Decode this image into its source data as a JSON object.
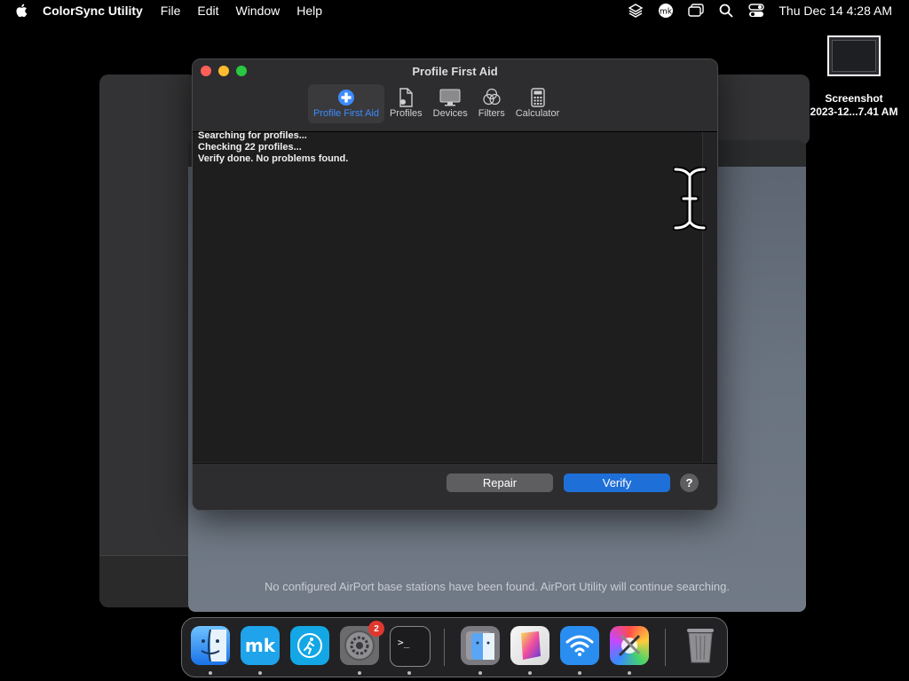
{
  "menubar": {
    "app_name": "ColorSync Utility",
    "menus": [
      "File",
      "Edit",
      "Window",
      "Help"
    ],
    "right_icons": [
      "layers-icon",
      "mk-icon",
      "window-switch-icon",
      "search-icon",
      "control-center-icon"
    ],
    "clock": "Thu Dec 14  4:28 AM"
  },
  "desktop_icon": {
    "name_line1": "Screenshot",
    "name_line2": "2023-12...7.41 AM"
  },
  "airport_window": {
    "message": "No configured AirPort base stations have been found. AirPort Utility will continue searching."
  },
  "window": {
    "title": "Profile First Aid",
    "toolbar": [
      {
        "label": "Profile First Aid",
        "icon": "first-aid-icon",
        "active": true
      },
      {
        "label": "Profiles",
        "icon": "profiles-icon",
        "active": false
      },
      {
        "label": "Devices",
        "icon": "devices-icon",
        "active": false
      },
      {
        "label": "Filters",
        "icon": "filters-icon",
        "active": false
      },
      {
        "label": "Calculator",
        "icon": "calculator-icon",
        "active": false
      }
    ],
    "log_lines": [
      "Searching for profiles...",
      "Checking 22 profiles...",
      "Verify done. No problems found."
    ],
    "repair_label": "Repair",
    "verify_label": "Verify",
    "help_label": "?"
  },
  "dock": {
    "items": [
      "Finder",
      "mk",
      "Fitness",
      "System Settings",
      "Terminal",
      "Finder Downloads",
      "ColorSync Utility",
      "AirPort Utility",
      "Color Utility",
      "Trash"
    ],
    "settings_badge": "2"
  },
  "colors": {
    "accent": "#1f6fd8",
    "active_tab": "#3d8bff"
  }
}
